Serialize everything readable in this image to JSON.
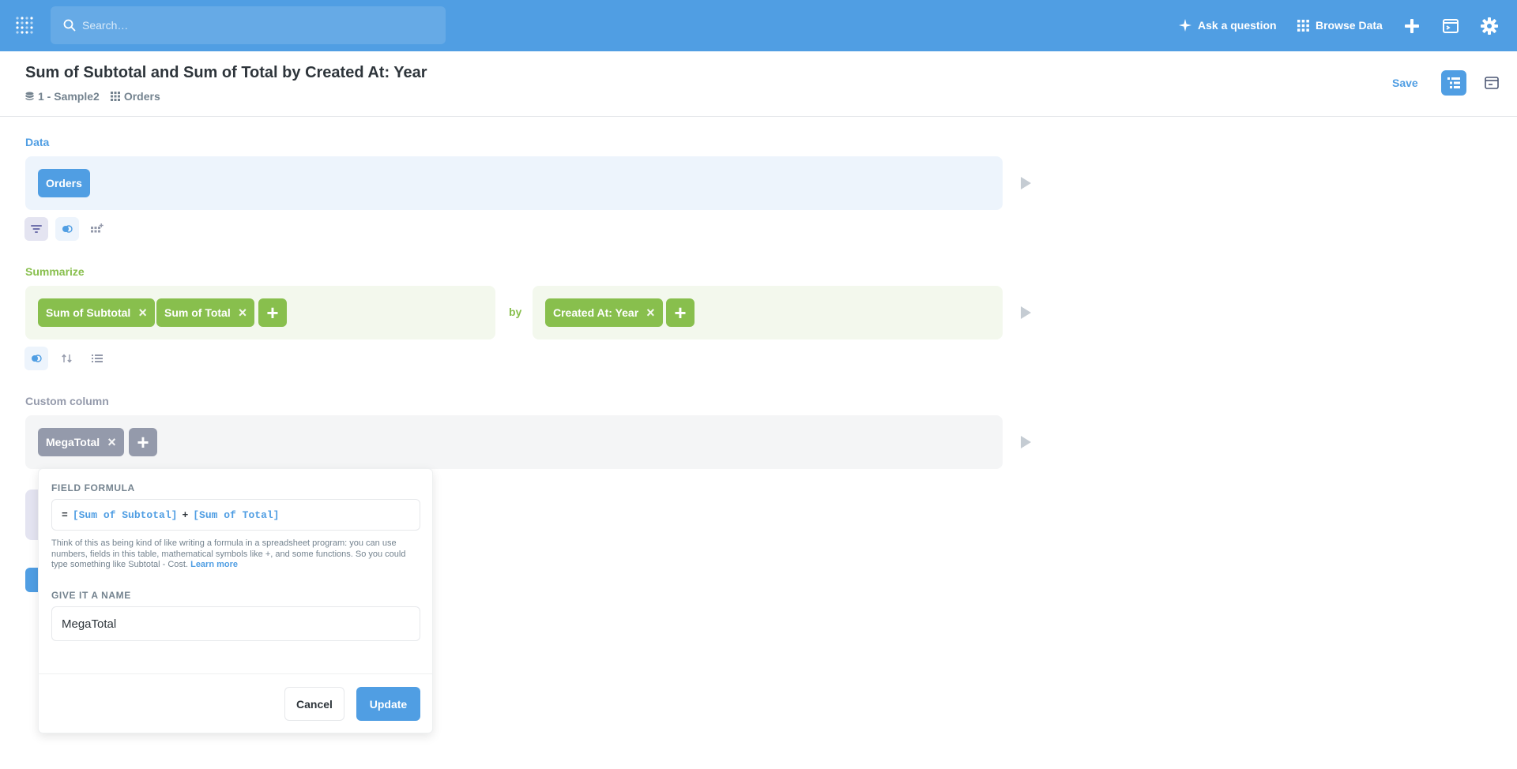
{
  "nav": {
    "search_placeholder": "Search…",
    "ask_question": "Ask a question",
    "browse_data": "Browse Data"
  },
  "header": {
    "title": "Sum of Subtotal and Sum of Total by Created At: Year",
    "database": "1 - Sample2",
    "table": "Orders",
    "save": "Save"
  },
  "data_step": {
    "label": "Data",
    "table": "Orders"
  },
  "summarize_step": {
    "label": "Summarize",
    "metrics": [
      "Sum of Subtotal",
      "Sum of Total"
    ],
    "by": "by",
    "breakouts": [
      "Created At: Year"
    ]
  },
  "custom_column_step": {
    "label": "Custom column",
    "columns": [
      "MegaTotal"
    ]
  },
  "popover": {
    "formula_label": "FIELD FORMULA",
    "formula": {
      "eq": "=",
      "field1": "[Sum of Subtotal]",
      "op": "+",
      "field2": "[Sum of Total]"
    },
    "help_text": "Think of this as being kind of like writing a formula in a spreadsheet program: you can use numbers, fields in this table, mathematical symbols like +, and some functions. So you could type something like Subtotal - Cost.",
    "learn_more": "Learn more",
    "name_label": "GIVE IT A NAME",
    "name_value": "MegaTotal",
    "cancel": "Cancel",
    "update": "Update"
  },
  "colors": {
    "brand": "#509ee3",
    "summarize": "#88bf4d",
    "custom": "#949aab",
    "filter": "#7172ad"
  }
}
